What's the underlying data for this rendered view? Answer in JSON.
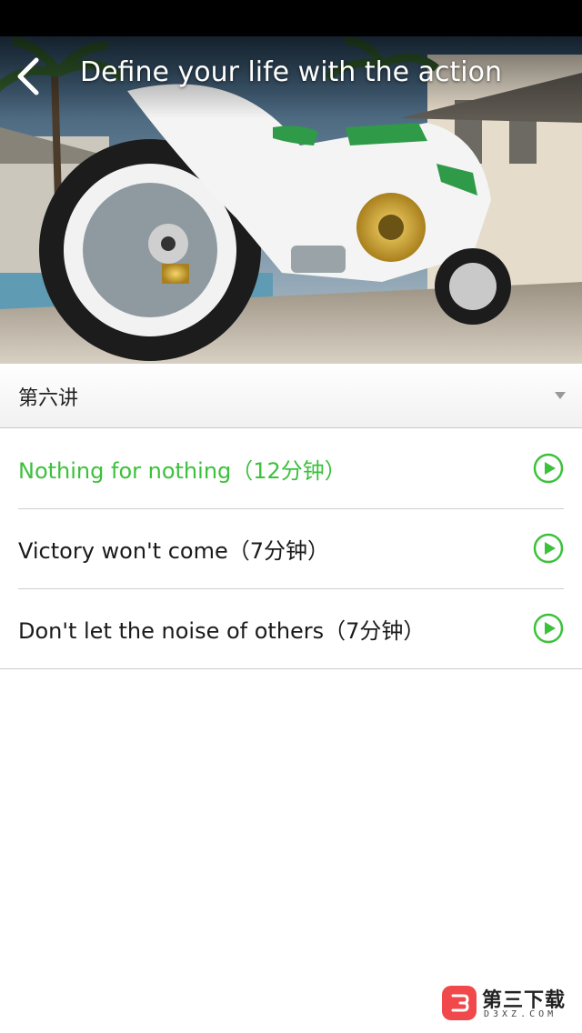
{
  "header": {
    "title": "Define your life with the action",
    "back_icon": "chevron-left-icon"
  },
  "hero": {
    "image_subject": "white-green-motorcycle-photo"
  },
  "selector": {
    "label": "第六讲",
    "icon": "caret-down-icon"
  },
  "lessons": [
    {
      "title": "Nothing for nothing（12分钟）",
      "active": true,
      "icon": "play-circle-icon"
    },
    {
      "title": "Victory won't come（7分钟）",
      "active": false,
      "icon": "play-circle-icon"
    },
    {
      "title": "Don't let the noise of others（7分钟）",
      "active": false,
      "icon": "play-circle-icon"
    }
  ],
  "watermark": {
    "name": "第三下载",
    "domain": "D3XZ.COM"
  },
  "colors": {
    "accent": "#3cc13c",
    "status_bar": "#000000",
    "divider": "#cfcfcf",
    "watermark_logo": "#f0484b"
  }
}
